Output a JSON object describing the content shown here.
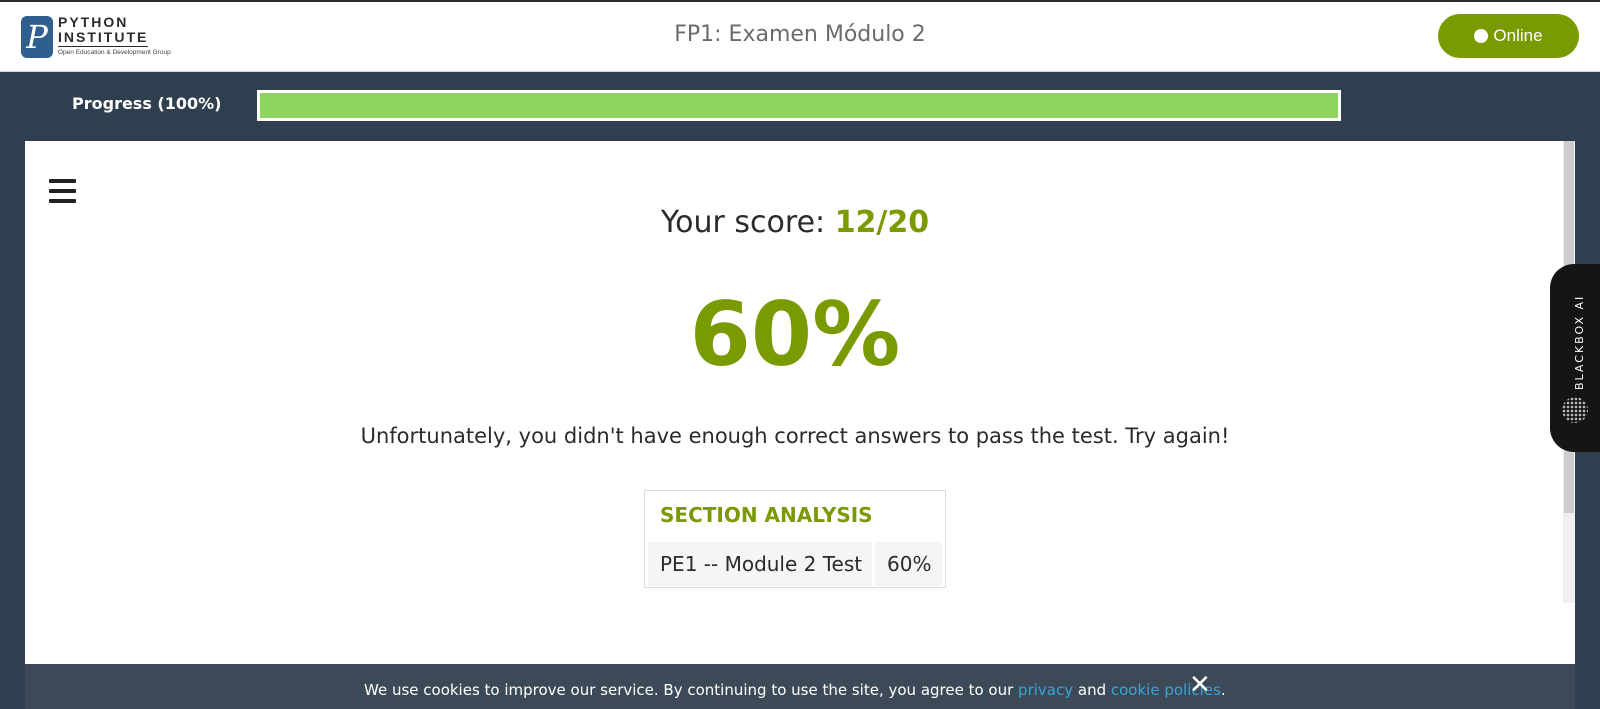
{
  "header": {
    "logo": {
      "mark": "P",
      "line1": "PYTHON",
      "line2": "INSTITUTE",
      "tagline": "Open Education & Development Group"
    },
    "title": "FP1: Examen Módulo 2",
    "status_button": "Online"
  },
  "progress": {
    "label": "Progress (100%)",
    "value": 1.0
  },
  "result": {
    "score_label": "Your score: ",
    "score_value": "12/20",
    "percent": "60%",
    "message": "Unfortunately, you didn't have enough correct answers to pass the test. Try again!"
  },
  "analysis": {
    "title": "SECTION ANALYSIS",
    "rows": [
      {
        "name": "PE1 -- Module 2 Test",
        "percent": "60%"
      }
    ]
  },
  "blackbox": {
    "label": "BLACKBOX AI"
  },
  "cookie": {
    "text_before": "We use cookies to improve our service. By continuing to use the site, you agree to our ",
    "link1": "privacy",
    "middle": " and ",
    "link2": "cookie policies",
    "text_after": ".",
    "close": "✕"
  },
  "colors": {
    "accent": "#7a9a01",
    "progress_fill": "#8fd45d",
    "background": "#2f3f4f",
    "link": "#3ba3d6"
  }
}
